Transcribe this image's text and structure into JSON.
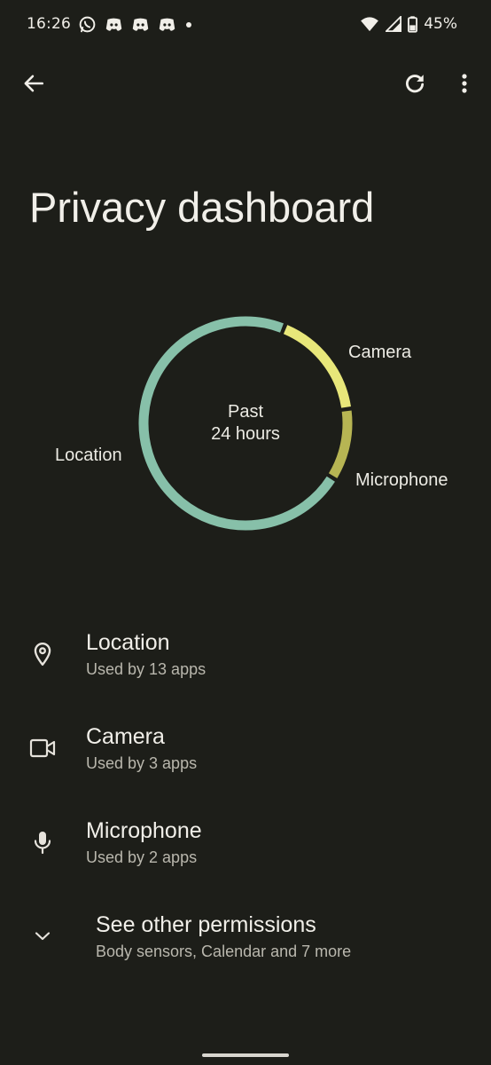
{
  "status_bar": {
    "time": "16:26",
    "battery_percent": "45%",
    "notification_icons": [
      "whatsapp-icon",
      "discord-icon",
      "discord-icon",
      "discord-icon",
      "dot-icon"
    ],
    "system_icons": [
      "wifi-icon",
      "signal-icon",
      "battery-icon"
    ]
  },
  "toolbar": {
    "back_icon": "arrow-back-icon",
    "refresh_icon": "refresh-icon",
    "more_icon": "more-vert-icon"
  },
  "header": {
    "title": "Privacy dashboard"
  },
  "chart_data": {
    "type": "pie",
    "style": "donut",
    "center_label_line1": "Past",
    "center_label_line2": "24 hours",
    "categories": [
      "Location",
      "Camera",
      "Microphone"
    ],
    "values": [
      13,
      3,
      2
    ],
    "colors": [
      "#87c0a9",
      "#e8e77a",
      "#b7b553"
    ]
  },
  "permissions": [
    {
      "icon": "location-pin-icon",
      "title": "Location",
      "subtitle": "Used by 13 apps"
    },
    {
      "icon": "videocam-icon",
      "title": "Camera",
      "subtitle": "Used by 3 apps"
    },
    {
      "icon": "microphone-icon",
      "title": "Microphone",
      "subtitle": "Used by 2 apps"
    }
  ],
  "other_permissions": {
    "icon": "chevron-down-icon",
    "title": "See other permissions",
    "subtitle": "Body sensors, Calendar and 7 more"
  }
}
